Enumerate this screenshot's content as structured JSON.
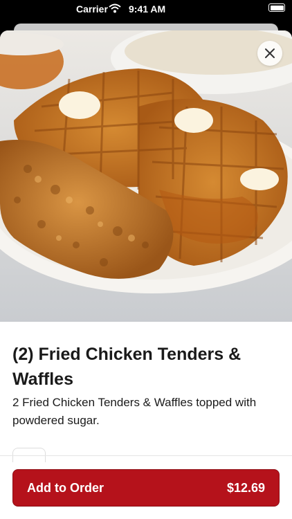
{
  "status_bar": {
    "carrier": "Carrier",
    "time": "9:41 AM"
  },
  "item": {
    "title": "(2) Fried Chicken Tenders & Waffles",
    "description": "2 Fried Chicken Tenders & Waffles topped with powdered sugar."
  },
  "footer": {
    "add_label": "Add to Order",
    "price": "$12.69"
  },
  "colors": {
    "accent": "#b5121b"
  }
}
